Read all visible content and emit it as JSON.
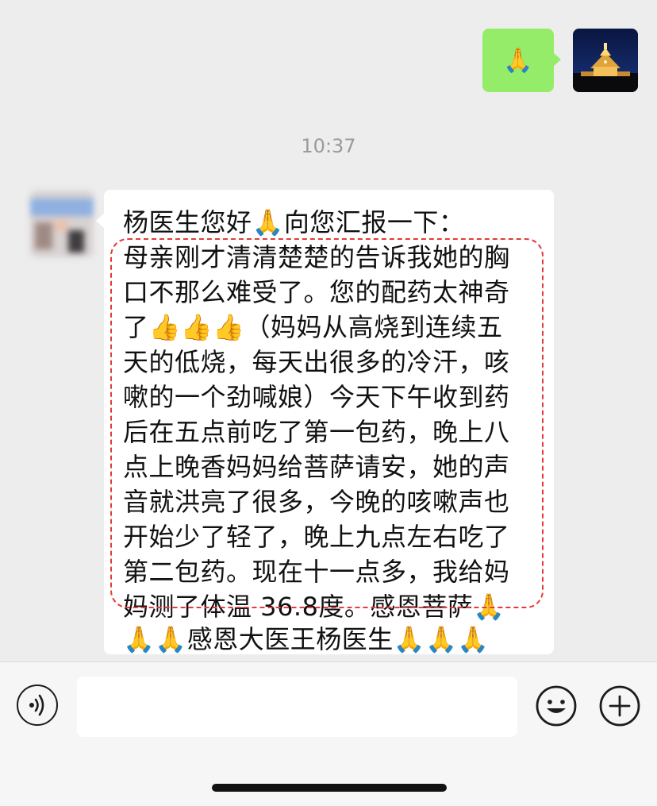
{
  "outgoing": {
    "message": "🙏"
  },
  "timestamp": "10:37",
  "incoming": {
    "lines": [
      "杨医生您好🙏向您汇报一下：",
      "母亲刚才清清楚楚的告诉我她的胸",
      "口不那么难受了。您的配药太神奇",
      "了👍👍👍（妈妈从高烧到连续五",
      "天的低烧，每天出很多的冷汗，咳",
      "嗽的一个劲喊娘）今天下午收到药",
      "后在五点前吃了第一包药，晚上八",
      "点上晚香妈妈给菩萨请安，她的声",
      "音就洪亮了很多，今晚的咳嗽声也",
      "开始少了轻了，晚上九点左右吃了",
      "第二包药。现在十一点多，我给妈",
      "妈测了体温 36.8度。感恩菩萨🙏",
      "🙏🙏感恩大医王杨医生🙏🙏🙏"
    ]
  },
  "input_bar": {
    "voice_icon": "voice-icon",
    "emoji_icon": "emoji-icon",
    "plus_icon": "plus-icon",
    "text_value": ""
  },
  "colors": {
    "outgoing_bubble": "#95ec69",
    "incoming_bubble": "#ffffff",
    "background": "#ededed",
    "highlight_box": "#e23b3b"
  }
}
